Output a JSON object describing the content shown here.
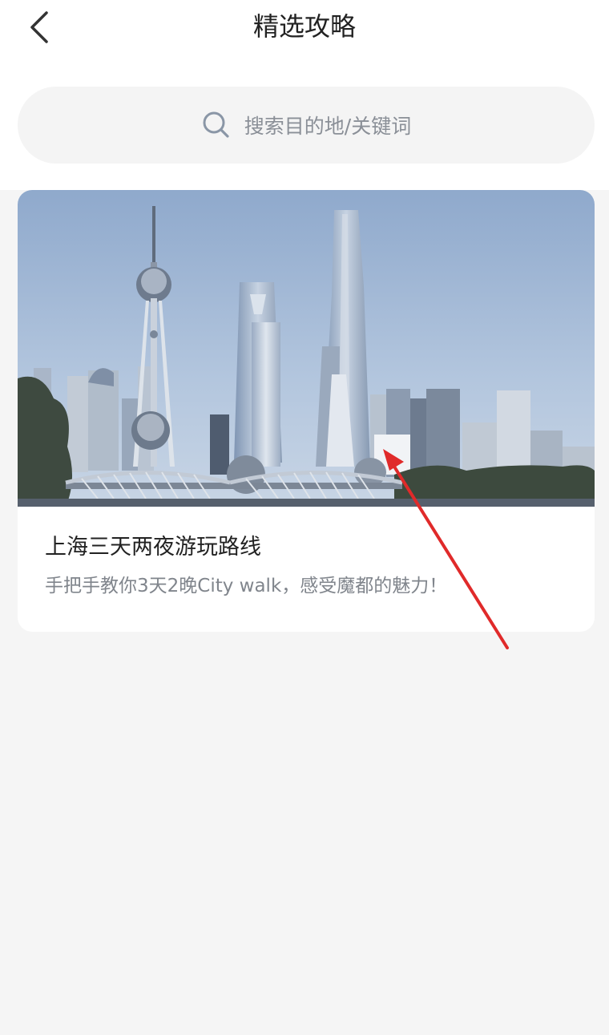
{
  "header": {
    "title": "精选攻略",
    "back_icon": "chevron-left-icon"
  },
  "search": {
    "placeholder": "搜索目的地/关键词",
    "icon": "search-icon"
  },
  "guides": [
    {
      "title": "上海三天两夜游玩路线",
      "subtitle": "手把手教你3天2晚City walk，感受魔都的魅力！",
      "image": "shanghai-skyline-photo"
    }
  ],
  "colors": {
    "page_background": "#f5f5f5",
    "card_background": "#ffffff",
    "title_text": "#222222",
    "secondary_text": "#80858c",
    "annotation_arrow": "#e02a2a"
  }
}
